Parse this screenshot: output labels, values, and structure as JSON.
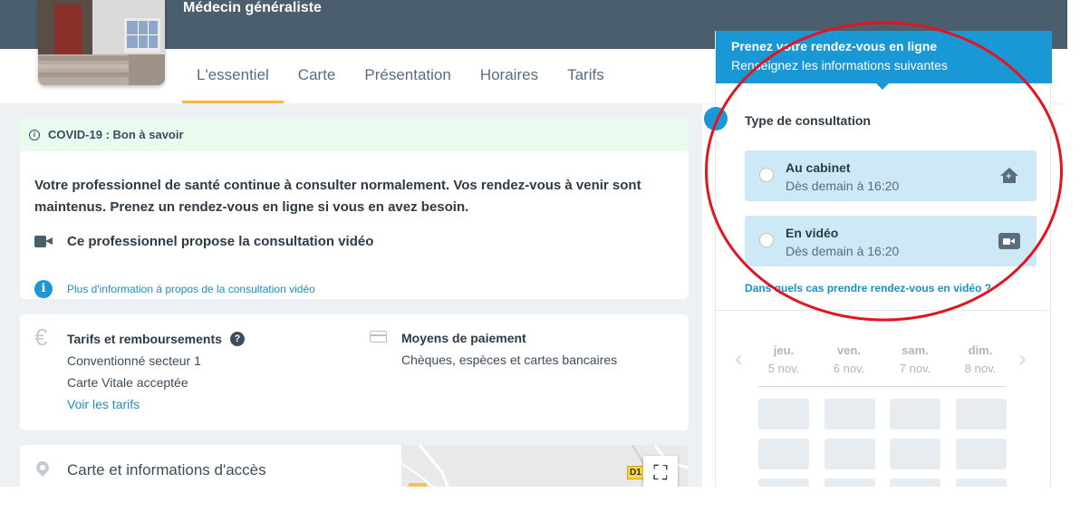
{
  "header": {
    "specialty": "Médecin généraliste",
    "tabs": [
      {
        "label": "L'essentiel",
        "active": true
      },
      {
        "label": "Carte"
      },
      {
        "label": "Présentation"
      },
      {
        "label": "Horaires"
      },
      {
        "label": "Tarifs"
      }
    ]
  },
  "covid": {
    "title": "COVID-19 : Bon à savoir",
    "message": "Votre professionnel de santé continue à consulter normalement. Vos rendez-vous à venir sont maintenus. Prenez un rendez-vous en ligne si vous en avez besoin.",
    "video_notice": "Ce professionnel propose la consultation vidéo",
    "info_link": "Plus d'information à propos de la consultation vidéo"
  },
  "tarifs": {
    "title": "Tarifs et remboursements",
    "sector": "Conventionné secteur 1",
    "vitale": "Carte Vitale acceptée",
    "link": "Voir les tarifs",
    "payment_title": "Moyens de paiement",
    "payment_methods": "Chèques, espèces et cartes bancaires"
  },
  "access": {
    "title": "Carte et informations d'accès",
    "road_label": "D1"
  },
  "booking": {
    "title": "Prenez votre rendez-vous en ligne",
    "subtitle": "Renseignez les informations suivantes",
    "step_title": "Type de consultation",
    "options": [
      {
        "label": "Au cabinet",
        "sub": "Dès demain à 16:20",
        "icon": "house-plus-icon"
      },
      {
        "label": "En vidéo",
        "sub": "Dès demain à 16:20",
        "icon": "video-icon"
      }
    ],
    "video_help_link": "Dans quels cas prendre rendez-vous en vidéo ?",
    "days": [
      {
        "name": "jeu.",
        "date": "5 nov."
      },
      {
        "name": "ven.",
        "date": "6 nov."
      },
      {
        "name": "sam.",
        "date": "7 nov."
      },
      {
        "name": "dim.",
        "date": "8 nov."
      }
    ]
  },
  "colors": {
    "primary": "#1a97d5",
    "header_band": "#4b5e6e",
    "active_tab": "#f6b93b",
    "annotation": "#e3141f"
  }
}
